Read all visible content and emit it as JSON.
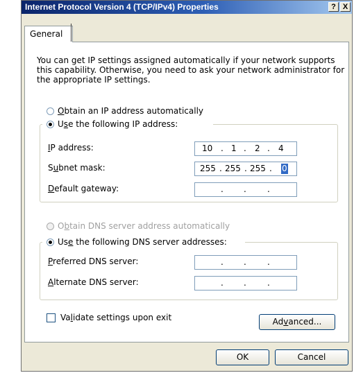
{
  "window": {
    "title": "Internet Protocol Version 4 (TCP/IPv4) Properties",
    "help_btn": "?",
    "close_btn": "X"
  },
  "tabs": [
    {
      "label": "General"
    }
  ],
  "description": "You can get IP settings assigned automatically if your network supports this capability. Otherwise, you need to ask your network administrator for the appropriate IP settings.",
  "ip": {
    "auto_label_pre": "",
    "auto_label_key": "O",
    "auto_label_post": "btain an IP address automatically",
    "manual_label_pre": "U",
    "manual_label_key": "s",
    "manual_label_post": "e the following IP address:",
    "selected": "manual",
    "fields": [
      {
        "label_key": "I",
        "label_rest": "P address:",
        "octets": [
          "10",
          "1",
          "2",
          "4"
        ]
      },
      {
        "label_pre": "S",
        "label_key": "u",
        "label_rest": "bnet mask:",
        "octets": [
          "255",
          "255",
          "255",
          "0"
        ]
      },
      {
        "label_key": "D",
        "label_rest": "efault gateway:",
        "octets": [
          "",
          "",
          "",
          ""
        ]
      }
    ]
  },
  "dns": {
    "auto_label_pre": "O",
    "auto_label_key": "b",
    "auto_label_post": "tain DNS server address automatically",
    "manual_label_pre": "Us",
    "manual_label_key": "e",
    "manual_label_post": " the following DNS server addresses:",
    "selected": "manual",
    "fields": [
      {
        "label_key": "P",
        "label_rest": "referred DNS server:",
        "octets": [
          "",
          "",
          "",
          ""
        ]
      },
      {
        "label_key": "A",
        "label_rest": "lternate DNS server:",
        "octets": [
          "",
          "",
          "",
          ""
        ]
      }
    ]
  },
  "validate": {
    "label_pre": "Va",
    "label_key": "l",
    "label_post": "idate settings upon exit",
    "checked": false
  },
  "buttons": {
    "advanced_pre": "Ad",
    "advanced_key": "v",
    "advanced_post": "anced...",
    "ok": "OK",
    "cancel": "Cancel"
  }
}
